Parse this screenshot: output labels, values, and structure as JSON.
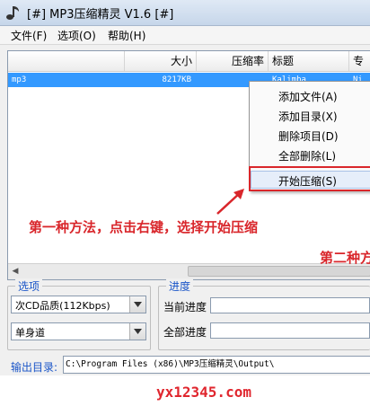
{
  "window": {
    "title": "[#] MP3压缩精灵 V1.6 [#]",
    "icon": "music-note-icon"
  },
  "menubar": {
    "items": [
      {
        "label": "文件(F)"
      },
      {
        "label": "选项(O)"
      },
      {
        "label": "帮助(H)"
      }
    ]
  },
  "file_list": {
    "columns": [
      "",
      "大小",
      "压缩率",
      "标题",
      "专"
    ],
    "rows": [
      {
        "name": "mp3",
        "size": "8217KB",
        "ratio": "",
        "title": "Kalimba",
        "extra": "Ni"
      }
    ]
  },
  "context_menu": {
    "items": [
      {
        "label": "添加文件(A)"
      },
      {
        "label": "添加目录(X)"
      },
      {
        "label": "删除项目(D)"
      },
      {
        "label": "全部删除(L)"
      },
      {
        "label": "开始压缩(S)"
      }
    ],
    "highlighted_index": 4
  },
  "annotation": {
    "text": "第一种方法，点击右键，选择开始压缩",
    "text2": "第二种方",
    "color": "#d9262b"
  },
  "options": {
    "title": "选项",
    "quality": "次CD品质(112Kbps)",
    "channel": "单身道"
  },
  "progress": {
    "title": "进度",
    "current_label": "当前进度",
    "total_label": "全部进度"
  },
  "output": {
    "label": "输出目录:",
    "path": "C:\\Program Files (x86)\\MP3压缩精灵\\Output\\"
  },
  "watermark": {
    "text": "yx12345.com"
  },
  "colors": {
    "selection": "#3399ff",
    "group_title": "#1a55c8",
    "annotation": "#d9262b"
  }
}
